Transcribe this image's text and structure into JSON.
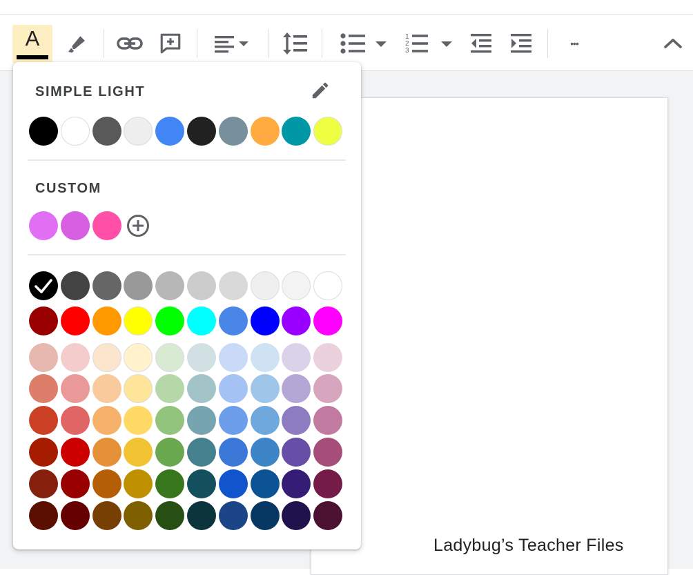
{
  "toolbar": {
    "text_color_letter": "A",
    "more_label": "•••",
    "icons": [
      "text-color",
      "highlight-pen",
      "link",
      "add-comment",
      "align-left",
      "dropdown",
      "line-spacing",
      "bulleted-list",
      "dropdown",
      "numbered-list",
      "dropdown",
      "decrease-indent",
      "increase-indent",
      "more",
      "collapse-chevron"
    ]
  },
  "palette": {
    "theme_title": "SIMPLE LIGHT",
    "theme_colors": [
      "#000000",
      "#ffffff",
      "#595959",
      "#eeeeee",
      "#4285f4",
      "#212121",
      "#78909c",
      "#ffab40",
      "#0097a7",
      "#eeff41"
    ],
    "custom_title": "CUSTOM",
    "custom_colors": [
      "#e06ff3",
      "#d65fe2",
      "#ff4fa7"
    ],
    "selected_color": "#000000",
    "standard_colors": [
      [
        "#000000",
        "#434343",
        "#666666",
        "#999999",
        "#b7b7b7",
        "#cccccc",
        "#d9d9d9",
        "#efefef",
        "#f3f3f3",
        "#ffffff"
      ],
      [
        "#980000",
        "#ff0000",
        "#ff9900",
        "#ffff00",
        "#00ff00",
        "#00ffff",
        "#4a86e8",
        "#0000ff",
        "#9900ff",
        "#ff00ff"
      ],
      [
        "#e6b8af",
        "#f4cccc",
        "#fce5cd",
        "#fff2cc",
        "#d9ead3",
        "#d0e0e3",
        "#c9daf8",
        "#cfe2f3",
        "#d9d2e9",
        "#ead1dc"
      ],
      [
        "#dd7e6b",
        "#ea9999",
        "#f9cb9c",
        "#ffe599",
        "#b6d7a8",
        "#a2c4c9",
        "#a4c2f4",
        "#9fc5e8",
        "#b4a7d6",
        "#d5a6bd"
      ],
      [
        "#cc4125",
        "#e06666",
        "#f6b26b",
        "#ffd966",
        "#93c47d",
        "#76a5af",
        "#6d9eeb",
        "#6fa8dc",
        "#8e7cc3",
        "#c27ba0"
      ],
      [
        "#a61c00",
        "#cc0000",
        "#e69138",
        "#f1c232",
        "#6aa84f",
        "#45818e",
        "#3c78d8",
        "#3d85c6",
        "#674ea7",
        "#a64d79"
      ],
      [
        "#85200c",
        "#990000",
        "#b45f06",
        "#bf9000",
        "#38761d",
        "#134f5c",
        "#1155cc",
        "#0b5394",
        "#351c75",
        "#741b47"
      ],
      [
        "#5b0f00",
        "#660000",
        "#783f04",
        "#7f6000",
        "#274e13",
        "#0c343d",
        "#1c4587",
        "#073763",
        "#20124d",
        "#4c1130"
      ]
    ]
  },
  "watermark": "Ladybug’s Teacher Files"
}
